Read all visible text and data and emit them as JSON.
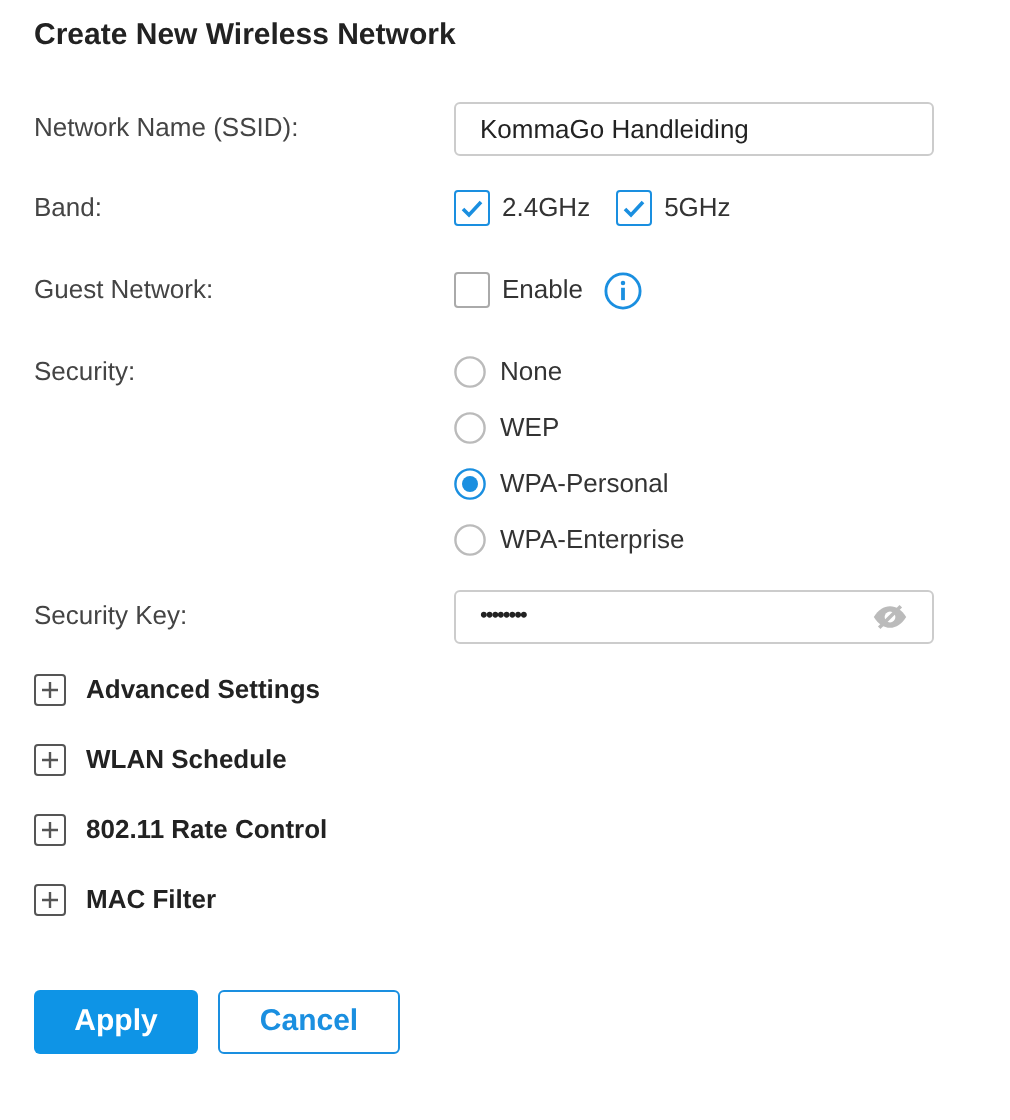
{
  "title": "Create New Wireless Network",
  "fields": [
    {
      "kind": "text",
      "label": "Network Name (SSID):",
      "value": "KommaGo Handleiding"
    },
    {
      "kind": "checkboxes",
      "label": "Band:",
      "options": [
        {
          "label": "2.4GHz",
          "checked": true
        },
        {
          "label": "5GHz",
          "checked": true
        }
      ]
    },
    {
      "kind": "checkboxes",
      "label": "Guest Network:",
      "info": true,
      "options": [
        {
          "label": "Enable",
          "checked": false
        }
      ]
    },
    {
      "kind": "radios",
      "label": "Security:",
      "options": [
        {
          "label": "None",
          "selected": false
        },
        {
          "label": "WEP",
          "selected": false
        },
        {
          "label": "WPA-Personal",
          "selected": true
        },
        {
          "label": "WPA-Enterprise",
          "selected": false
        }
      ]
    },
    {
      "kind": "password",
      "label": "Security Key:",
      "value": "••••••••"
    }
  ],
  "sections": [
    {
      "label": "Advanced Settings",
      "expanded": false
    },
    {
      "label": "WLAN Schedule",
      "expanded": false
    },
    {
      "label": "802.11 Rate Control",
      "expanded": false
    },
    {
      "label": "MAC Filter",
      "expanded": false
    }
  ],
  "buttons": [
    {
      "label": "Apply",
      "kind": "primary"
    },
    {
      "label": "Cancel",
      "kind": "secondary"
    }
  ]
}
